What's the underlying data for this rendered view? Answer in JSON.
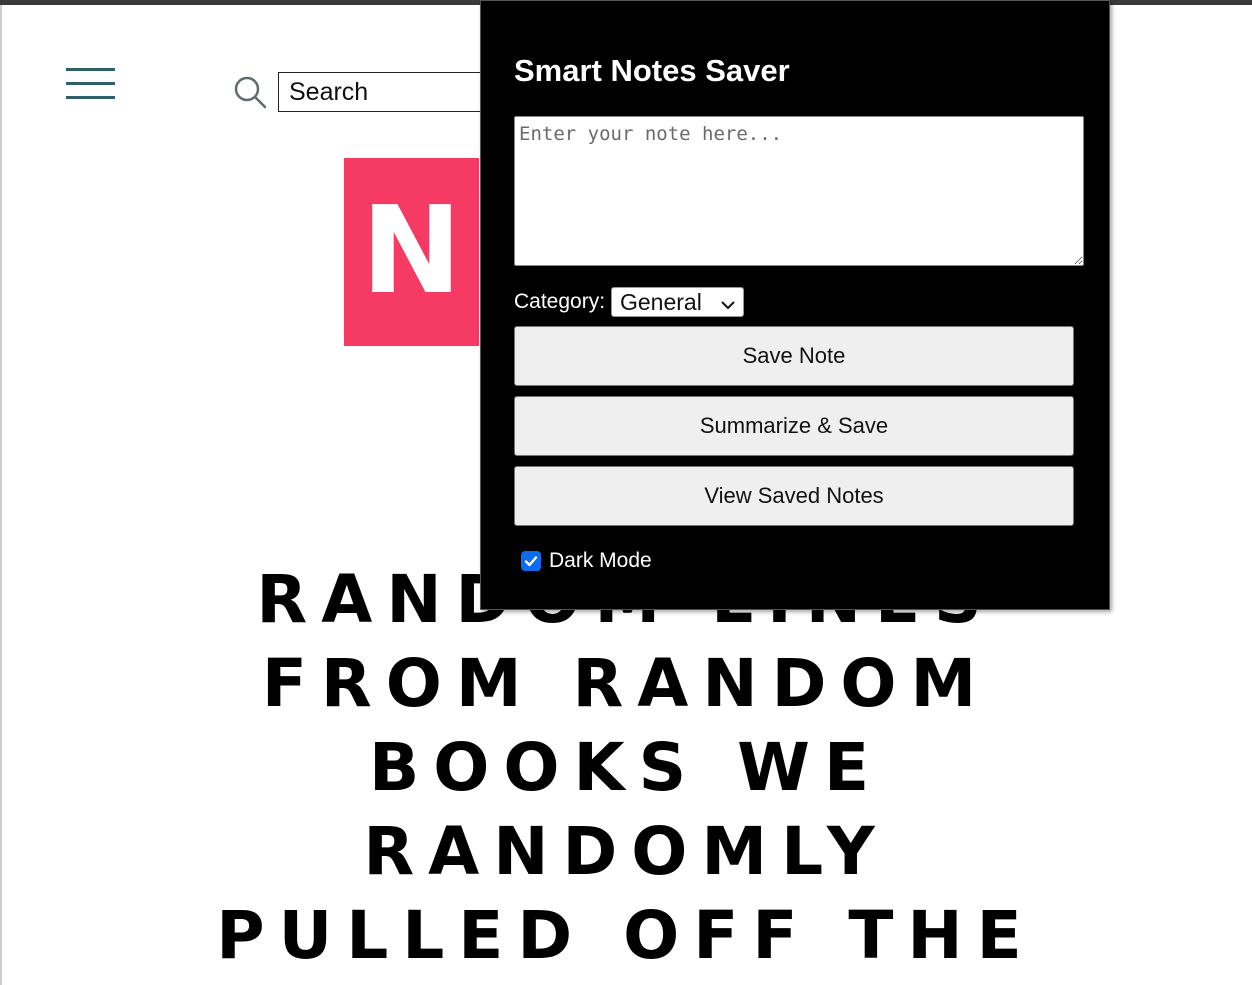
{
  "site": {
    "search": {
      "value": "Search"
    },
    "logo": {
      "letter": "N",
      "color": "#f53a64"
    },
    "headline": {
      "lines": [
        "RANDOM LINES",
        "FROM RANDOM",
        "BOOKS WE",
        "RANDOMLY",
        "PULLED OFF THE"
      ]
    }
  },
  "popup": {
    "title": "Smart Notes Saver",
    "note": {
      "placeholder": "Enter your note here...",
      "value": ""
    },
    "category": {
      "label": "Category:",
      "selected": "General"
    },
    "buttons": {
      "save": "Save Note",
      "summarize": "Summarize & Save",
      "view": "View Saved Notes"
    },
    "dark_mode": {
      "label": "Dark Mode",
      "checked": true
    }
  },
  "colors": {
    "popup_bg": "#000000",
    "accent": "#0b6cf0",
    "menu": "#2f5f6b"
  }
}
